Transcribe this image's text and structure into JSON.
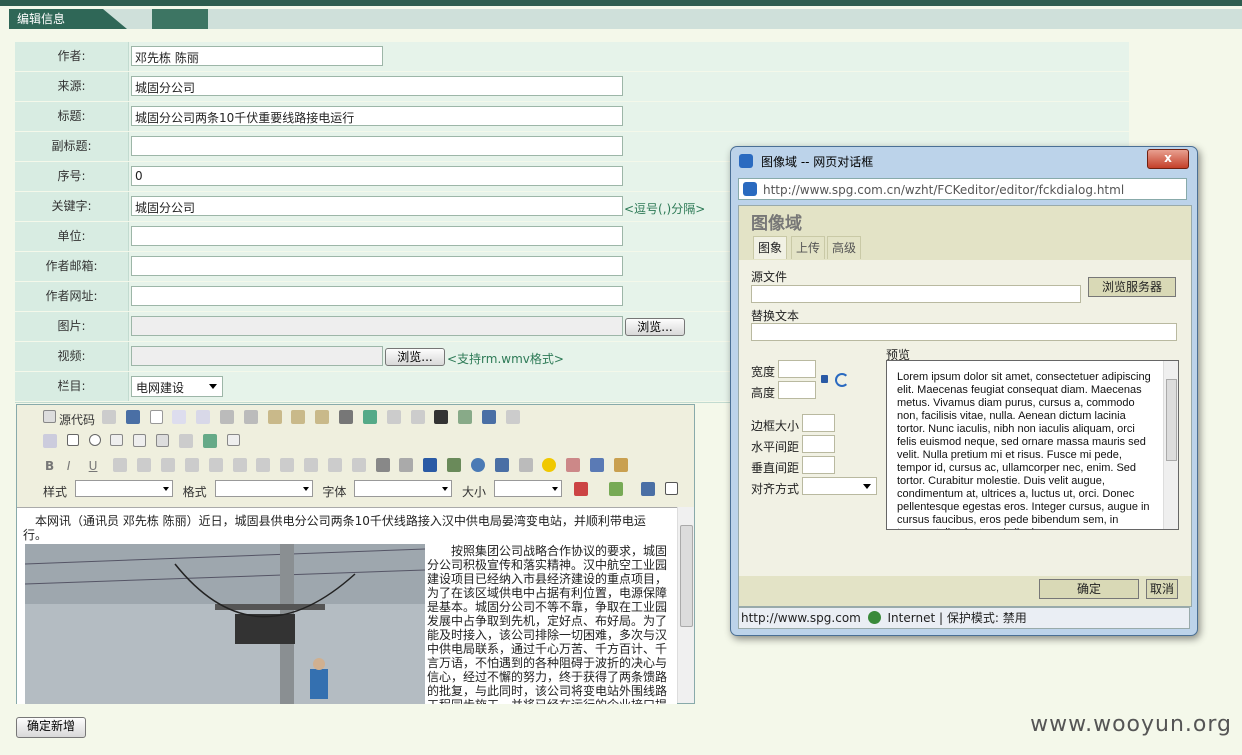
{
  "header": {
    "tab_label": "编辑信息"
  },
  "form": {
    "author_label": "作者:",
    "author_value": "邓先栋 陈丽",
    "source_label": "来源:",
    "source_value": "城固分公司",
    "title_label": "标题:",
    "title_value": "城固分公司两条10千伏重要线路接电运行",
    "subtitle_label": "副标题:",
    "subtitle_value": "",
    "order_label": "序号:",
    "order_value": "0",
    "keyword_label": "关键字:",
    "keyword_value": "城固分公司",
    "keyword_hint": "<逗号(,)分隔>",
    "unit_label": "单位:",
    "unit_value": "",
    "email_label": "作者邮箱:",
    "email_value": "",
    "website_label": "作者网址:",
    "website_value": "",
    "image_label": "图片:",
    "image_browse": "浏览...",
    "video_label": "视频:",
    "video_browse": "浏览...",
    "video_hint": "<支持rm.wmv格式>",
    "column_label": "栏目:",
    "column_value": "电网建设"
  },
  "editor": {
    "source_code_label": "源代码",
    "style_label": "样式",
    "format_label": "格式",
    "font_label": "字体",
    "size_label": "大小",
    "lead_text": "本网讯（通讯员 邓先栋 陈丽）近日，城固县供电分公司两条10千伏线路接入汉中供电局晏湾变电站，并顺利带电运行。",
    "body_text": "按照集团公司战略合作协议的要求，城固分公司积极宣传和落实精神。汉中航空工业园建设项目已经纳入市县经济建设的重点项目，为了在该区域供电中占据有利位置，电源保障是基本。城固分公司不等不靠，争取在工业园发展中占争取到先机，定好点、布好局。为了能及时接入，该公司排除一切困难，多次与汉中供电局联系，通过千心万苦、千方百计、千言万语，不怕遇到的各种阻碍于波折的决心与信心，经过不懈的努力，终于获得了两条馈路的批复，与此同时，该公司将变电站外围线路工程同步施工，并将已经在运行的企业接口提"
  },
  "submit_label": "确定新增",
  "watermark": "www.wooyun.org",
  "dialog": {
    "window_title": "图像域 -- 网页对话框",
    "close_symbol": "x",
    "address": "http://www.spg.com.cn/wzht/FCKeditor/editor/fckdialog.html",
    "heading": "图像域",
    "tabs": [
      "图象",
      "上传",
      "高级"
    ],
    "source_file_label": "源文件",
    "browse_server_label": "浏览服务器",
    "alt_text_label": "替换文本",
    "width_label": "宽度",
    "height_label": "高度",
    "preview_label": "预览",
    "border_label": "边框大小",
    "hspace_label": "水平间距",
    "vspace_label": "垂直间距",
    "align_label": "对齐方式",
    "preview_text": "Lorem ipsum dolor sit amet, consectetuer adipiscing elit. Maecenas feugiat consequat diam. Maecenas metus. Vivamus diam purus, cursus a, commodo non, facilisis vitae, nulla. Aenean dictum lacinia tortor. Nunc iaculis, nibh non iaculis aliquam, orci felis euismod neque, sed ornare massa mauris sed velit. Nulla pretium mi et risus. Fusce mi pede, tempor id, cursus ac, ullamcorper nec, enim. Sed tortor. Curabitur molestie. Duis velit augue, condimentum at, ultrices a, luctus ut, orci. Donec pellentesque egestas eros. Integer cursus, augue in cursus faucibus, eros pede bibendum sem, in tempus tellus justo quis ligula.",
    "ok_label": "确定",
    "cancel_label": "取消",
    "status_url": "http://www.spg.com",
    "status_zone": "Internet | 保护模式: 禁用"
  }
}
